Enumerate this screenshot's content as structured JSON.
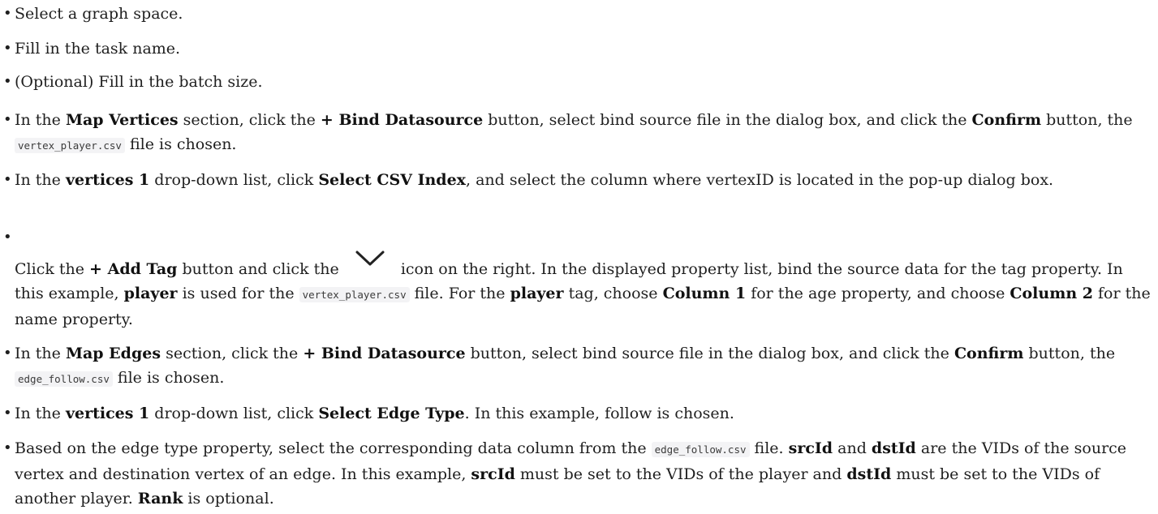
{
  "items": [
    {
      "segments": [
        {
          "t": "Select a graph space."
        }
      ]
    },
    {
      "segments": [
        {
          "t": "Fill in the task name."
        }
      ]
    },
    {
      "segments": [
        {
          "t": "(Optional) Fill in the batch size."
        }
      ]
    },
    {
      "segments": [
        {
          "t": "In the "
        },
        {
          "t": "Map Vertices",
          "s": "b"
        },
        {
          "t": " section, click the "
        },
        {
          "t": "+ Bind Datasource",
          "s": "b"
        },
        {
          "t": " button, select bind source file in the dialog box, and click the "
        },
        {
          "t": "Confirm",
          "s": "b"
        },
        {
          "t": " button, the "
        },
        {
          "t": "vertex_player.csv",
          "s": "code"
        },
        {
          "t": " file is chosen."
        }
      ]
    },
    {
      "segments": [
        {
          "t": "In the "
        },
        {
          "t": "vertices 1",
          "s": "b"
        },
        {
          "t": " drop-down list, click "
        },
        {
          "t": "Select CSV Index",
          "s": "b"
        },
        {
          "t": ", and select the column where vertexID is located in the pop-up dialog box."
        }
      ]
    },
    {
      "lead_gap": true,
      "segments": [
        {
          "t": "Click the "
        },
        {
          "t": "+ Add Tag",
          "s": "b"
        },
        {
          "t": " button and click the "
        },
        {
          "s": "icon",
          "icon": "chevron-down-icon"
        },
        {
          "t": " icon on the right. In the displayed property list, bind the source data for the tag property. In this example, "
        },
        {
          "t": "player",
          "s": "b"
        },
        {
          "t": " is used for the "
        },
        {
          "t": "vertex_player.csv",
          "s": "code"
        },
        {
          "t": " file. For the "
        },
        {
          "t": "player",
          "s": "b"
        },
        {
          "t": " tag, choose "
        },
        {
          "t": "Column 1",
          "s": "b"
        },
        {
          "t": " for the age property, and choose "
        },
        {
          "t": "Column 2",
          "s": "b"
        },
        {
          "t": " for the name property."
        }
      ]
    },
    {
      "segments": [
        {
          "t": "In the "
        },
        {
          "t": "Map Edges",
          "s": "b"
        },
        {
          "t": " section, click the "
        },
        {
          "t": "+ Bind Datasource",
          "s": "b"
        },
        {
          "t": " button, select bind source file in the dialog box, and click the "
        },
        {
          "t": "Confirm",
          "s": "b"
        },
        {
          "t": " button, the "
        },
        {
          "t": "edge_follow.csv",
          "s": "code"
        },
        {
          "t": " file is chosen."
        }
      ]
    },
    {
      "segments": [
        {
          "t": "In the "
        },
        {
          "t": "vertices 1",
          "s": "b"
        },
        {
          "t": " drop-down list, click "
        },
        {
          "t": "Select Edge Type",
          "s": "b"
        },
        {
          "t": ". In this example, follow is chosen."
        }
      ]
    },
    {
      "segments": [
        {
          "t": "Based on the edge type property, select the corresponding data column from the "
        },
        {
          "t": "edge_follow.csv",
          "s": "code"
        },
        {
          "t": " file. "
        },
        {
          "t": "srcId",
          "s": "b"
        },
        {
          "t": " and "
        },
        {
          "t": "dstId",
          "s": "b"
        },
        {
          "t": " are the VIDs of the source vertex and destination vertex of an edge. In this example, "
        },
        {
          "t": "srcId",
          "s": "b"
        },
        {
          "t": " must be set to the VIDs of the player and "
        },
        {
          "t": "dstId",
          "s": "b"
        },
        {
          "t": " must be set to the VIDs of another player. "
        },
        {
          "t": "Rank",
          "s": "b"
        },
        {
          "t": " is optional."
        }
      ]
    }
  ]
}
